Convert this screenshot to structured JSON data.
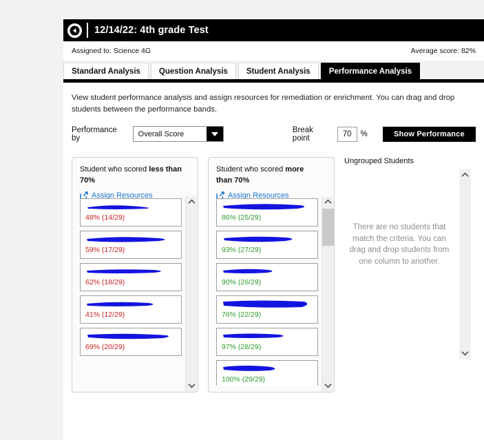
{
  "header": {
    "back_icon": "back-arrow-circle-icon",
    "title": "12/14/22: 4th grade Test",
    "assigned_to": "Assigned to: Science 4G",
    "average_score": "Average score: 82%"
  },
  "tabs": [
    {
      "label": "Standard Analysis",
      "active": false
    },
    {
      "label": "Question Analysis",
      "active": false
    },
    {
      "label": "Student Analysis",
      "active": false
    },
    {
      "label": "Performance Analysis",
      "active": true
    }
  ],
  "main": {
    "description": "View student performance analysis and assign resources for remediation or enrichment. You can drag and drop students between the performance bands.",
    "controls": {
      "performance_by_label": "Performance by",
      "performance_by_value": "Overall Score",
      "performance_by_options": [
        "Overall Score"
      ],
      "dropdown_icon": "chevron-down-icon",
      "break_point_label": "Break point",
      "break_point_value": "70",
      "break_point_unit": "%",
      "show_performance_label": "Show Performance"
    }
  },
  "bands": [
    {
      "title_prefix": "Student who scored ",
      "title_emphasis": "less than 70%",
      "assign_label": "Assign Resources",
      "assign_icon": "external-link-icon",
      "score_color": "#cc2020",
      "students": [
        {
          "name_redacted": true,
          "score": "48% (14/29)"
        },
        {
          "name_redacted": true,
          "score": "59% (17/29)"
        },
        {
          "name_redacted": true,
          "score": "62% (18/29)"
        },
        {
          "name_redacted": true,
          "score": "41% (12/29)"
        },
        {
          "name_redacted": true,
          "score": "69% (20/29)"
        }
      ]
    },
    {
      "title_prefix": "Student who scored ",
      "title_emphasis": "more than 70%",
      "assign_label": "Assign Resources",
      "assign_icon": "external-link-icon",
      "score_color": "#2d9b2d",
      "students": [
        {
          "name_redacted": true,
          "score": "86% (25/29)"
        },
        {
          "name_redacted": true,
          "score": "93% (27/29)"
        },
        {
          "name_redacted": true,
          "score": "90% (26/29)"
        },
        {
          "name_redacted": true,
          "score": "76% (22/29)"
        },
        {
          "name_redacted": true,
          "score": "97% (28/29)"
        },
        {
          "name_redacted": true,
          "score": "100% (29/29)"
        }
      ]
    }
  ],
  "ungrouped": {
    "title": "Ungrouped Students",
    "empty_message": "There are no students that match the criteria. You can drag and drop students from one column to another."
  }
}
